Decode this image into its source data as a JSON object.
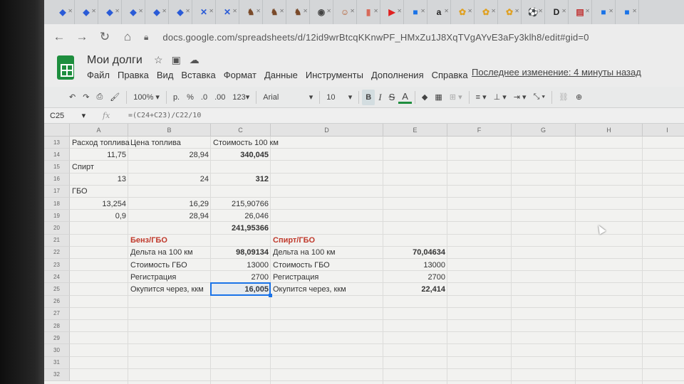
{
  "browser": {
    "tabs": [
      {
        "icon": "diamond-icon",
        "color": "#2a5bd7"
      },
      {
        "icon": "diamond-icon",
        "color": "#2a5bd7"
      },
      {
        "icon": "diamond-icon",
        "color": "#2a5bd7"
      },
      {
        "icon": "diamond-icon",
        "color": "#2a5bd7"
      },
      {
        "icon": "diamond-icon",
        "color": "#2a5bd7"
      },
      {
        "icon": "diamond-icon",
        "color": "#2a5bd7"
      },
      {
        "icon": "cross-icon",
        "color": "#2a5bd7"
      },
      {
        "icon": "cross-icon",
        "color": "#2a5bd7"
      },
      {
        "icon": "horse-icon",
        "color": "#7a4a2a"
      },
      {
        "icon": "horse-icon",
        "color": "#7a4a2a"
      },
      {
        "icon": "horse-icon",
        "color": "#7a4a2a"
      },
      {
        "icon": "globe-icon",
        "color": "#444444"
      },
      {
        "icon": "avatar-icon",
        "color": "#b3592a"
      },
      {
        "icon": "bookmark-icon",
        "color": "#d76a5a"
      },
      {
        "icon": "youtube-icon",
        "color": "#e02020"
      },
      {
        "icon": "square-icon",
        "color": "#1a73e8"
      },
      {
        "icon": "amazon-icon",
        "color": "#222222"
      },
      {
        "icon": "puzzle-icon",
        "color": "#e0a020"
      },
      {
        "icon": "puzzle-icon",
        "color": "#e0a020"
      },
      {
        "icon": "puzzle-icon",
        "color": "#e0a020"
      },
      {
        "icon": "ball-icon",
        "color": "#333333"
      },
      {
        "icon": "dou-icon",
        "color": "#222222"
      },
      {
        "icon": "book-icon",
        "color": "#c03030"
      },
      {
        "icon": "square-icon",
        "color": "#1a73e8"
      },
      {
        "icon": "square-icon",
        "color": "#1a73e8"
      }
    ],
    "url": "docs.google.com/spreadsheets/d/12id9wrBtcqKKnwPF_HMxZu1J8XqTVgAYvE3aFy3klh8/edit#gid=0"
  },
  "doc": {
    "title": "Мои долги",
    "menu": [
      "Файл",
      "Правка",
      "Вид",
      "Вставка",
      "Формат",
      "Данные",
      "Инструменты",
      "Дополнения",
      "Справка"
    ],
    "last_edit": "Последнее изменение: 4 минуты назад"
  },
  "format_toolbar": {
    "zoom": "100%",
    "currency": "р.",
    "percent": "%",
    "dec_decrease": ".0",
    "dec_increase": ".00",
    "number_format": "123",
    "font": "Arial",
    "font_size": "10",
    "bold": "B",
    "italic": "I",
    "strike": "S",
    "text_color": "A"
  },
  "formula_bar": {
    "cell_ref": "C25",
    "fx": "fx",
    "formula": "=(C24+C23)/C22/10"
  },
  "columns": [
    "A",
    "B",
    "C",
    "D",
    "E",
    "F",
    "G",
    "H",
    "I"
  ],
  "rows": [
    "13",
    "14",
    "15",
    "16",
    "17",
    "18",
    "19",
    "20",
    "21",
    "22",
    "23",
    "24",
    "25",
    "26",
    "27",
    "28",
    "29",
    "30",
    "31",
    "32"
  ],
  "cells": {
    "A13": "Расход топлива",
    "B13": "Цена топлива",
    "C13": "Стоимость 100 км",
    "A14": "11,75",
    "B14": "28,94",
    "C14": "340,045",
    "A15": "Спирт",
    "A16": "13",
    "B16": "24",
    "C16": "312",
    "A17": "ГБО",
    "A18": "13,254",
    "B18": "16,29",
    "C18": "215,90766",
    "A19": "0,9",
    "B19": "28,94",
    "C19": "26,046",
    "C20": "241,95366",
    "B21": "Бенз/ГБО",
    "D21": "Спирт/ГБО",
    "B22": "Дельта на 100 км",
    "C22": "98,09134",
    "D22": "Дельта на 100 км",
    "E22": "70,04634",
    "B23": "Стоимость ГБО",
    "C23": "13000",
    "D23": "Стоимость ГБО",
    "E23": "13000",
    "B24": "Регистрация",
    "C24": "2700",
    "D24": "Регистрация",
    "E24": "2700",
    "B25": "Окупится через, ккм",
    "C25": "16,005",
    "D25": "Окупится через, ккм",
    "E25": "22,414"
  },
  "colors": {
    "accent_green": "#1e8e3e",
    "selection_blue": "#1a73e8",
    "header_red": "#c0392b"
  }
}
